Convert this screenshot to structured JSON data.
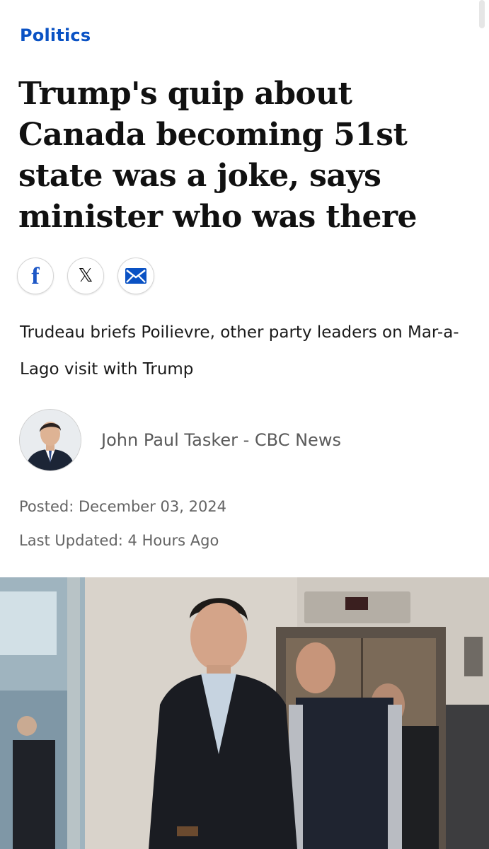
{
  "article": {
    "section": "Politics",
    "headline": "Trump's quip about Canada becoming 51st state was a joke, says minister who was there",
    "subheadline": "Trudeau briefs Poilievre, other party leaders on Mar-a-Lago visit with Trump",
    "byline": "John Paul Tasker - CBC News",
    "posted": "Posted: December 03, 2024",
    "last_updated": "Last Updated: 4 Hours Ago"
  },
  "share": {
    "facebook_label": "f",
    "x_label": "𝕏",
    "icons": [
      "facebook-icon",
      "x-icon",
      "email-icon"
    ]
  },
  "colors": {
    "section_link": "#0a52c4",
    "email_icon": "#0a52c4",
    "facebook_icon": "#1d57c6"
  }
}
